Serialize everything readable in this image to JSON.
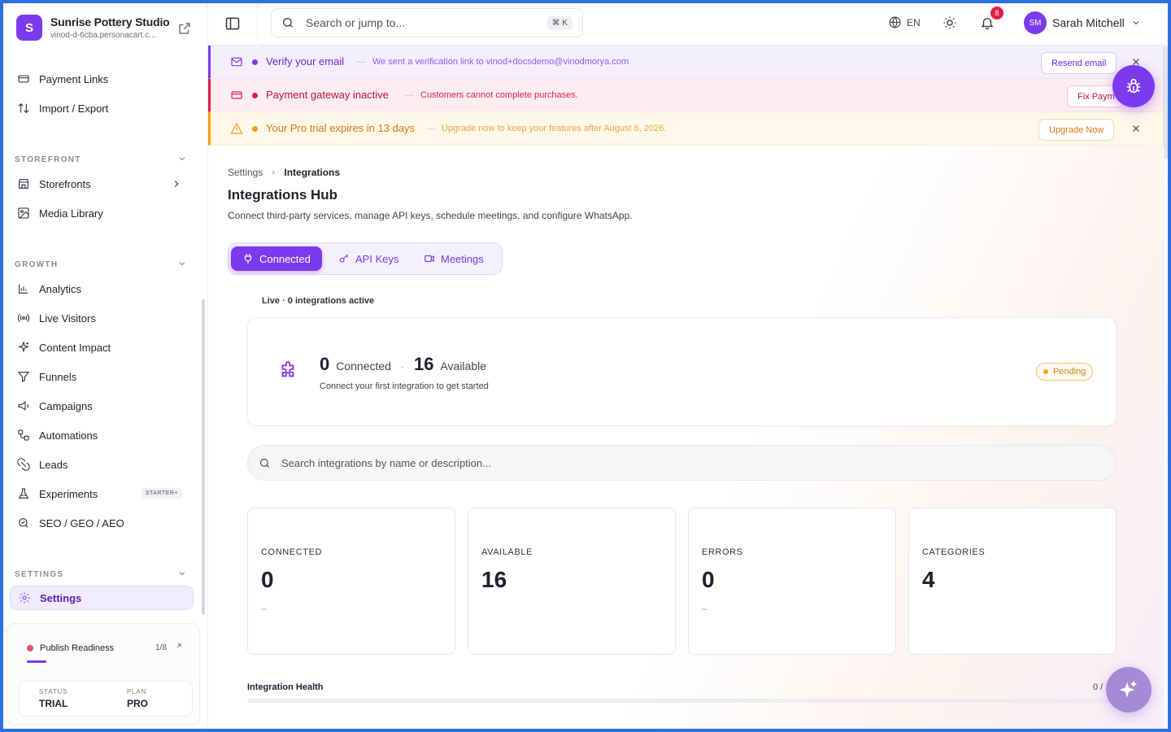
{
  "brand": {
    "initial": "S",
    "name": "Sunrise Pottery Studio",
    "subdomain": "vinod-d-6cba.personacart.c..."
  },
  "sidebar": {
    "top_items": [
      {
        "label": "Payment Links",
        "icon": "link-icon"
      },
      {
        "label": "Import / Export",
        "icon": "arrows-updown-icon"
      }
    ],
    "storefront_label": "STOREFRONT",
    "storefront_items": [
      {
        "label": "Storefronts",
        "icon": "store-icon"
      },
      {
        "label": "Media Library",
        "icon": "image-icon"
      }
    ],
    "growth_label": "GROWTH",
    "growth_items": [
      {
        "label": "Analytics",
        "icon": "bar-chart-icon"
      },
      {
        "label": "Live Visitors",
        "icon": "radio-icon"
      },
      {
        "label": "Content Impact",
        "icon": "sparkles-icon"
      },
      {
        "label": "Funnels",
        "icon": "funnel-icon"
      },
      {
        "label": "Campaigns",
        "icon": "megaphone-icon"
      },
      {
        "label": "Automations",
        "icon": "workflow-icon"
      },
      {
        "label": "Leads",
        "icon": "magnet-icon"
      },
      {
        "label": "Experiments",
        "icon": "flask-icon",
        "badge": "STARTER+"
      },
      {
        "label": "SEO / GEO / AEO",
        "icon": "seo-search-icon"
      }
    ],
    "settings_label": "SETTINGS",
    "settings_item": {
      "label": "Settings",
      "icon": "gear-icon"
    },
    "publish": {
      "label": "Publish Readiness",
      "count": "1/8",
      "progress": 0.125
    },
    "status_label": "STATUS",
    "status_value": "TRIAL",
    "plan_label": "PLAN",
    "plan_value": "PRO"
  },
  "topbar": {
    "search_placeholder": "Search or jump to...",
    "search_shortcut": "⌘ K",
    "language": "EN",
    "notifications_count": "8",
    "user_initials": "SM",
    "user_name": "Sarah Mitchell"
  },
  "banners": {
    "email": {
      "title": "Verify your email",
      "dash": "—",
      "desc": "We sent a verification link to vinod+docsdemo@vinodmorya.com",
      "button": "Resend email"
    },
    "payment": {
      "title": "Payment gateway inactive",
      "dash": "—",
      "desc": "Customers cannot complete purchases.",
      "button": "Fix Paym"
    },
    "trial": {
      "title": "Your Pro trial expires in 13 days",
      "dash": "—",
      "desc": "Upgrade now to keep your features after August 6, 2026.",
      "button": "Upgrade Now"
    }
  },
  "main": {
    "breadcrumb_root": "Settings",
    "breadcrumb_current": "Integrations",
    "title": "Integrations Hub",
    "subtitle": "Connect third-party services, manage API keys, schedule meetings, and configure WhatsApp.",
    "tabs": [
      {
        "label": "Connected",
        "active": true
      },
      {
        "label": "API Keys",
        "active": false
      },
      {
        "label": "Meetings",
        "active": false
      }
    ],
    "live_label": "Live · 0 integrations active",
    "summary": {
      "connected_num": "0",
      "connected_label": "Connected",
      "dot": "·",
      "available_num": "16",
      "available_label": "Available",
      "hint": "Connect your first integration to get started",
      "status": "Pending"
    },
    "search_placeholder": "Search integrations by name or description...",
    "stats": [
      {
        "label": "CONNECTED",
        "value": "0",
        "sub": "–"
      },
      {
        "label": "AVAILABLE",
        "value": "16",
        "sub": ""
      },
      {
        "label": "ERRORS",
        "value": "0",
        "sub": "–"
      },
      {
        "label": "CATEGORIES",
        "value": "4",
        "sub": ""
      }
    ],
    "health_label": "Integration Health",
    "health_count": "0 / 16"
  },
  "colors": {
    "accent": "#7c3aed",
    "danger": "#e11d48",
    "warning": "#f59e0b"
  }
}
